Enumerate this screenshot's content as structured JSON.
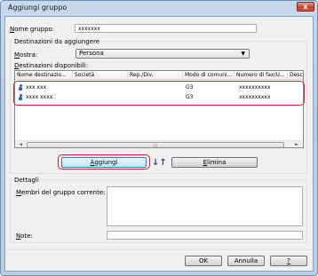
{
  "window": {
    "title": "Aggiungi gruppo",
    "close_glyph": "x"
  },
  "group_name": {
    "label_prefix": "N",
    "label_rest": "ome gruppo:",
    "value": "xxxxxxx"
  },
  "destinations_section": {
    "title": "Destinazioni da aggiungere"
  },
  "show": {
    "label_prefix": "M",
    "label_rest": "ostra:",
    "selected": "Persona"
  },
  "available": {
    "label_prefix": "D",
    "label_rest": "estinazioni disponibili:"
  },
  "table": {
    "columns": [
      "Nome destinazio...",
      "Società",
      "Rep./Div.",
      "Modo di comuni...",
      "Numero di fax/U...",
      "Desc"
    ],
    "rows": [
      {
        "name": "xxx xxx",
        "company": "",
        "dept": "",
        "mode": "G3",
        "number": "xxxxxxxxxx",
        "desc": ""
      },
      {
        "name": "xxxx xxxx",
        "company": "",
        "dept": "",
        "mode": "G3",
        "number": "xxxxxxxxxx",
        "desc": ""
      }
    ]
  },
  "scrollbar": {
    "left_arrow": "◄",
    "right_arrow": "►",
    "grip": "|||"
  },
  "actions": {
    "add_prefix": "A",
    "add_rest": "ggiungi",
    "arrows": "↓↑",
    "delete_prefix": "E",
    "delete_rest": "limina"
  },
  "details": {
    "title": "Dettagli",
    "members_prefix": "M",
    "members_rest": "embri del gruppo corrente:",
    "notes_prefix": "N",
    "notes_rest": "ote:"
  },
  "footer": {
    "ok": "OK",
    "cancel": "Annulla",
    "help": "?"
  },
  "colors": {
    "highlight": "#d0212f",
    "person_icon": "#2f5fb3"
  }
}
